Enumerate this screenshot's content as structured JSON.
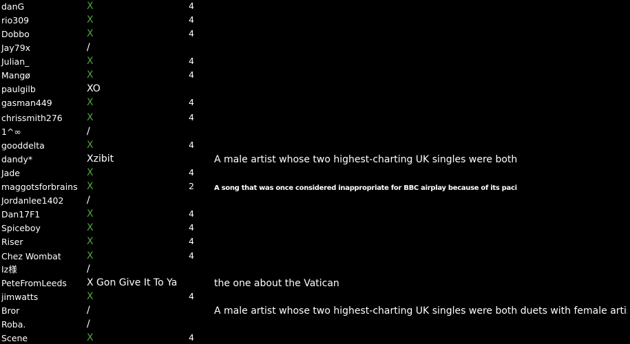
{
  "colors": {
    "background": "#000000",
    "text": "#ffffff",
    "correct_mark": "#4fa63d"
  },
  "rows": [
    {
      "name": "danG",
      "answer": "X",
      "answer_kind": "mark",
      "score": "4",
      "note": ""
    },
    {
      "name": "rio309",
      "answer": "X",
      "answer_kind": "mark",
      "score": "4",
      "note": ""
    },
    {
      "name": "Dobbo",
      "answer": "X",
      "answer_kind": "mark",
      "score": "4",
      "note": ""
    },
    {
      "name": "Jay79x",
      "answer": "/",
      "answer_kind": "text",
      "score": "",
      "note": ""
    },
    {
      "name": "Julian_",
      "answer": "X",
      "answer_kind": "mark",
      "score": "4",
      "note": ""
    },
    {
      "name": "Mangø",
      "answer": "X",
      "answer_kind": "mark",
      "score": "4",
      "note": ""
    },
    {
      "name": "paulgilb",
      "answer": "XO",
      "answer_kind": "text",
      "score": "",
      "note": ""
    },
    {
      "name": "gasman449",
      "answer": "X",
      "answer_kind": "mark",
      "score": "4",
      "note": ""
    },
    {
      "name": "chrissmith276",
      "answer": "X",
      "answer_kind": "mark",
      "score": "4",
      "note": ""
    },
    {
      "name": "1^∞",
      "answer": "/",
      "answer_kind": "text",
      "score": "",
      "note": ""
    },
    {
      "name": "gooddelta",
      "answer": "X",
      "answer_kind": "mark",
      "score": "4",
      "note": ""
    },
    {
      "name": "dandy*",
      "answer": "Xzibit",
      "answer_kind": "text",
      "score": "",
      "note": "A male artist whose two highest-charting UK singles were both duets with f",
      "note_style": "normal"
    },
    {
      "name": "Jade",
      "answer": "X",
      "answer_kind": "mark",
      "score": "4",
      "note": ""
    },
    {
      "name": "maggotsforbrains",
      "answer": "X",
      "answer_kind": "mark",
      "score": "2",
      "note": "A song that was once considered inappropriate for BBC airplay because of its pacifist message",
      "note_style": "tiny"
    },
    {
      "name": "Jordanlee1402",
      "answer": "/",
      "answer_kind": "text",
      "score": "",
      "note": ""
    },
    {
      "name": "Dan17F1",
      "answer": "X",
      "answer_kind": "mark",
      "score": "4",
      "note": ""
    },
    {
      "name": "Spiceboy",
      "answer": "X",
      "answer_kind": "mark",
      "score": "4",
      "note": ""
    },
    {
      "name": "Riser",
      "answer": "X",
      "answer_kind": "mark",
      "score": "4",
      "note": ""
    },
    {
      "name": "Chez Wombat",
      "answer": "X",
      "answer_kind": "mark",
      "score": "4",
      "note": ""
    },
    {
      "name": "Iz様",
      "answer": "/",
      "answer_kind": "text",
      "score": "",
      "note": ""
    },
    {
      "name": "PeteFromLeeds",
      "answer": "X Gon Give It To Ya",
      "answer_kind": "text",
      "score": "",
      "note": "the one about the Vatican",
      "note_style": "normal"
    },
    {
      "name": "jimwatts",
      "answer": "X",
      "answer_kind": "mark",
      "score": "4",
      "note": ""
    },
    {
      "name": "Bror",
      "answer": "/",
      "answer_kind": "text",
      "score": "",
      "note": "A male artist whose two highest-charting UK singles were both duets with female artists.",
      "note_style": "full"
    },
    {
      "name": "Roba.",
      "answer": "/",
      "answer_kind": "text",
      "score": "",
      "note": ""
    },
    {
      "name": "Scene",
      "answer": "X",
      "answer_kind": "mark",
      "score": "4",
      "note": ""
    }
  ]
}
